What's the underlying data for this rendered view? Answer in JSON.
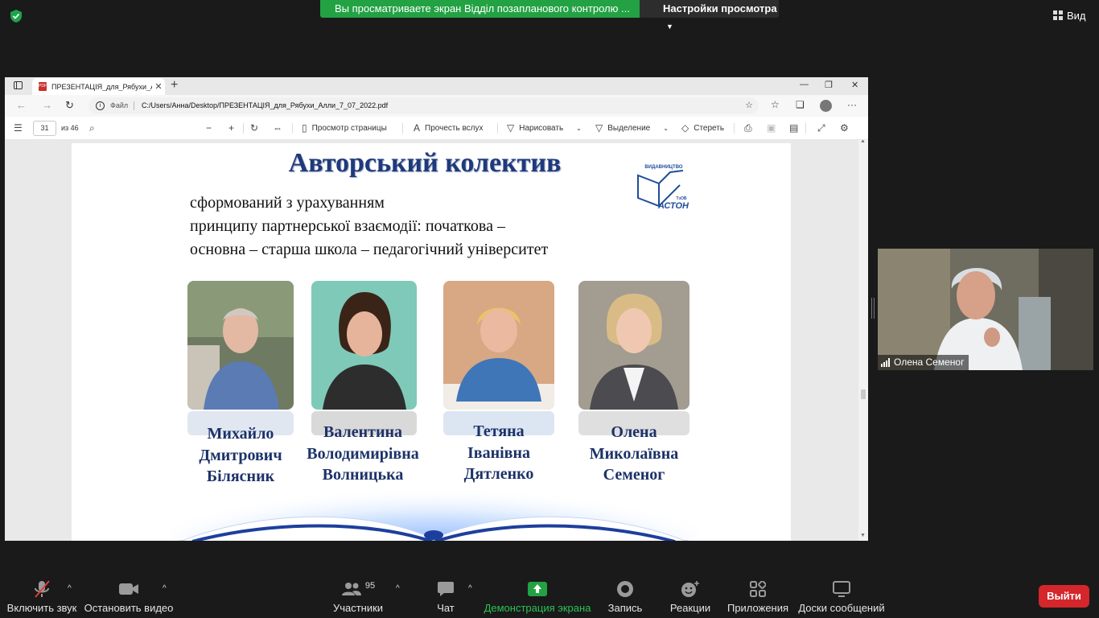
{
  "zoom": {
    "share_banner": "Вы  просматриваете экран  Відділ позапланового контролю ...",
    "view_settings": "Настройки просмотра",
    "view_button": "Вид",
    "participant_name": "Олена Семеног",
    "participants_count": "95",
    "toolbar": {
      "mute": "Включить звук",
      "video": "Остановить видео",
      "participants": "Участники",
      "chat": "Чат",
      "share": "Демонстрация экрана",
      "record": "Запись",
      "reactions": "Реакции",
      "apps": "Приложения",
      "whiteboards": "Доски сообщений",
      "leave": "Выйти"
    },
    "colors": {
      "share_green": "#23a244",
      "leave_red": "#d4262b",
      "toolbar_bg": "#1a1a1a"
    }
  },
  "browser": {
    "tab_title": "ПРЕЗЕНТАЦІЯ_для_Рябухи_Алл...",
    "address_label": "Файл",
    "address_path": "C:/Users/Анна/Desktop/ПРЕЗЕНТАЦІЯ_для_Рябухи_Алли_7_07_2022.pdf",
    "pdf_toolbar": {
      "page_number": "31",
      "page_total": "из 46",
      "page_view": "Просмотр страницы",
      "read_aloud": "Прочесть вслух",
      "draw": "Нарисовать",
      "highlight": "Выделение",
      "erase": "Стереть"
    }
  },
  "slide": {
    "title": "Авторський колектив",
    "subtitle_lines": [
      "сформований з урахуванням",
      "принципу партнерської взаємодії:  початкова –",
      "основна –  старша школа –  педагогічний університет"
    ],
    "logo": {
      "line1": "ВИДАВНИЦТВО",
      "line2": "ТзОВ",
      "line3": "АСТОН"
    },
    "authors": [
      {
        "line1": "Михайло",
        "line2": "Дмитрович",
        "line3": "Білясник"
      },
      {
        "line1": "Валентина",
        "line2": "Володимирівна",
        "line3": "Волницька"
      },
      {
        "line1": "Тетяна",
        "line2": "Іванівна",
        "line3": "Дятленко"
      },
      {
        "line1": "Олена",
        "line2": "Миколаївна",
        "line3": "Семеног"
      }
    ]
  }
}
